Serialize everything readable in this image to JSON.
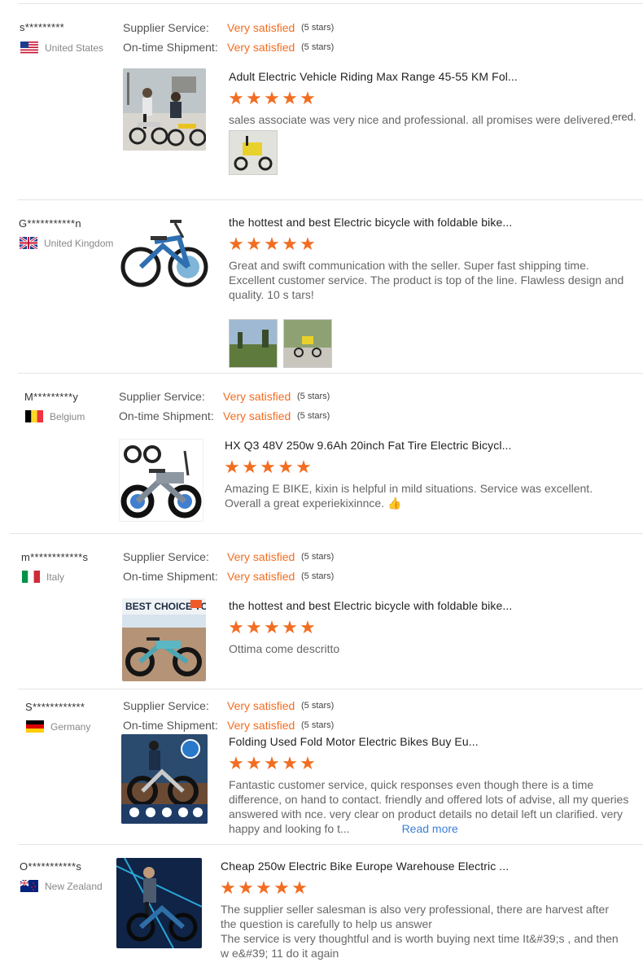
{
  "labels": {
    "supplier_service": "Supplier Service:",
    "ontime_shipment": "On-time Shipment:"
  },
  "reviews": [
    {
      "user": "s*********",
      "country": "United States",
      "flag_icon": "us-flag-icon",
      "supplier_value": "Very satisfied",
      "supplier_stars": "(5 stars)",
      "shipment_value": "Very satisfied",
      "shipment_stars": "(5 stars)",
      "product_title": "Adult Electric Vehicle Riding Max Range 45-55 KM Fol...",
      "rating": 5,
      "comment": "sales associate was very nice and professional. all promises were delivered.",
      "comment_extra": "ered."
    },
    {
      "user": "G***********n",
      "country": "United Kingdom",
      "flag_icon": "uk-flag-icon",
      "product_title": "the hottest and best Electric bicycle with foldable bike...",
      "rating": 5,
      "comment": "Great and swift communication with the seller. Super fast shipping time. Excellent customer service. The product is top of the line. Flawless design and quality. 10 s tars!"
    },
    {
      "user": "M*********y",
      "country": "Belgium",
      "flag_icon": "belgium-flag-icon",
      "supplier_value": "Very satisfied",
      "supplier_stars": "(5 stars)",
      "shipment_value": "Very satisfied",
      "shipment_stars": "(5 stars)",
      "product_title": "HX Q3 48V 250w 9.6Ah 20inch Fat Tire Electric Bicycl...",
      "rating": 5,
      "comment": "Amazing E BIKE, kixin is helpful in mild situations. Service was excellent. Overall a great experiekixinnce. 👍"
    },
    {
      "user": "m************s",
      "country": "Italy",
      "flag_icon": "italy-flag-icon",
      "supplier_value": "Very satisfied",
      "supplier_stars": "(5 stars)",
      "shipment_value": "Very satisfied",
      "shipment_stars": "(5 stars)",
      "product_title": "the hottest and best Electric bicycle with foldable bike...",
      "thumb_banner": "BEST CHOICE TO",
      "rating": 5,
      "comment": "Ottima come descritto"
    },
    {
      "user": "S************",
      "country": "Germany",
      "flag_icon": "germany-flag-icon",
      "supplier_value": "Very satisfied",
      "supplier_stars": "(5 stars)",
      "shipment_value": "Very satisfied",
      "shipment_stars": "(5 stars)",
      "product_title": "Folding Used Fold Motor Electric Bikes Buy Eu...",
      "rating": 5,
      "comment": "Fantastic customer service, quick responses even though there is a time difference, on hand to contact. friendly and offered lots of advise, all my queries answered with nce. very clear on product details no detail left un clarified. very happy and looking fo t...",
      "read_more": "Read more"
    },
    {
      "user": "O***********s",
      "country": "New Zealand",
      "flag_icon": "new-zealand-flag-icon",
      "product_title": "Cheap 250w Electric Bike Europe Warehouse Electric ...",
      "rating": 5,
      "comment": "The supplier seller salesman is also very professional, there are harvest after the question is carefully to help us answer",
      "comment2": "The service is very thoughtful and is worth buying next time It&#39;s , and then w e&#39; 11 do it again"
    }
  ]
}
